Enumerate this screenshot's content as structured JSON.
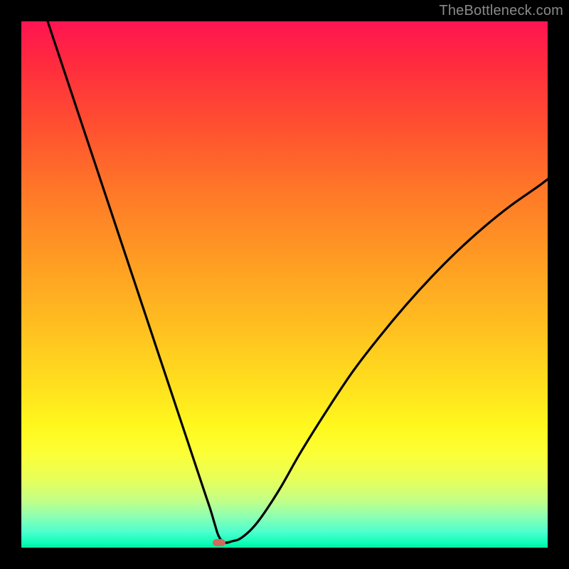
{
  "watermark": "TheBottleneck.com",
  "colors": {
    "frame": "#000000",
    "gradient_top": "#ff1452",
    "gradient_bottom": "#00eea0",
    "curve": "#000000",
    "marker": "#d06a5a"
  },
  "chart_data": {
    "type": "line",
    "title": "",
    "xlabel": "",
    "ylabel": "",
    "xlim": [
      0,
      100
    ],
    "ylim": [
      0,
      100
    ],
    "grid": false,
    "legend": false,
    "series": [
      {
        "name": "bottleneck-curve",
        "x": [
          5,
          8,
          11,
          14,
          17,
          20,
          23,
          26,
          29,
          32,
          33.5,
          35,
          36,
          36.8,
          37.5,
          38.5,
          40,
          42,
          45,
          49,
          53,
          58,
          63,
          68,
          73,
          78,
          83,
          88,
          93,
          98,
          100
        ],
        "y": [
          100,
          91,
          82,
          73,
          64,
          55,
          46,
          37,
          28,
          19,
          14.5,
          10,
          7,
          4.3,
          2.2,
          1.0,
          1.2,
          2.0,
          5.0,
          11,
          18,
          26,
          33.5,
          40,
          46,
          51.5,
          56.5,
          61,
          65,
          68.5,
          70
        ]
      }
    ],
    "annotations": [
      {
        "name": "min-marker",
        "x": 37.5,
        "y": 1.0
      }
    ],
    "background_gradient": {
      "direction": "vertical",
      "meaning": "low-y = good (green), high-y = bad (red)",
      "stops": [
        {
          "pos": 0.0,
          "color": "#ff1452"
        },
        {
          "pos": 0.5,
          "color": "#ffbf20"
        },
        {
          "pos": 0.8,
          "color": "#fff81e"
        },
        {
          "pos": 1.0,
          "color": "#00eea0"
        }
      ]
    }
  }
}
